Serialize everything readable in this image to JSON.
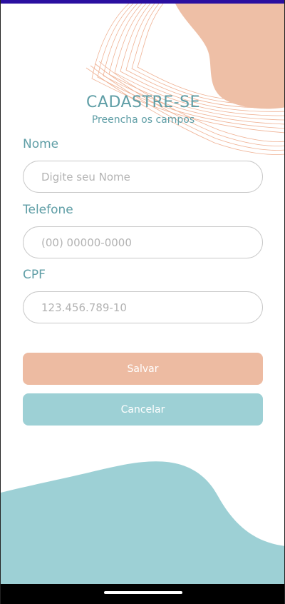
{
  "header": {
    "title": "CADASTRE-SE",
    "subtitle": "Preencha os campos"
  },
  "form": {
    "fields": [
      {
        "label": "Nome",
        "value": "",
        "placeholder": "Digite seu Nome"
      },
      {
        "label": "Telefone",
        "value": "",
        "placeholder": "(00) 00000-0000"
      },
      {
        "label": "CPF",
        "value": "",
        "placeholder": "123.456.789-10"
      }
    ],
    "save_label": "Salvar",
    "cancel_label": "Cancelar"
  },
  "colors": {
    "accent_teal": "#5f9ea6",
    "save_button": "#edbba2",
    "cancel_button": "#9dd0d5",
    "status_bar": "#2a0fa0"
  }
}
